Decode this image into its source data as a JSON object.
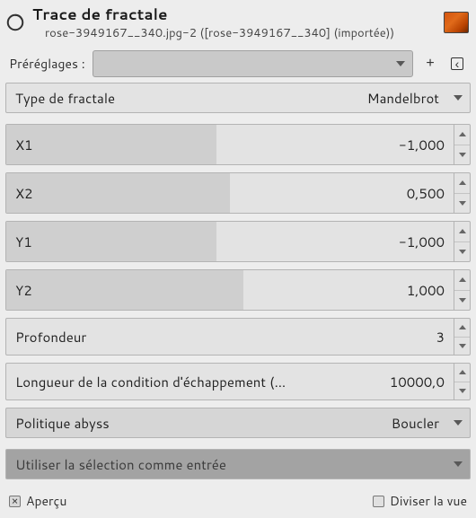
{
  "header": {
    "title": "Trace de fractale",
    "subtitle": "rose-3949167__340.jpg-2 ([rose-3949167__340] (importée))"
  },
  "presets": {
    "label": "Préréglages :"
  },
  "fractal_type": {
    "label": "Type de fractale",
    "value": "Mandelbrot"
  },
  "params": {
    "x1": {
      "label": "X1",
      "value": "-1,000",
      "fill_pct": 47
    },
    "x2": {
      "label": "X2",
      "value": "0,500",
      "fill_pct": 50
    },
    "y1": {
      "label": "Y1",
      "value": "-1,000",
      "fill_pct": 47
    },
    "y2": {
      "label": "Y2",
      "value": "1,000",
      "fill_pct": 53
    },
    "depth": {
      "label": "Profondeur",
      "value": "3",
      "fill_pct": 0
    },
    "escape": {
      "label": "Longueur de la condition d'échappement (…",
      "value": "10000,0",
      "fill_pct": 0
    }
  },
  "abyss": {
    "label": "Politique abyss",
    "value": "Boucler"
  },
  "use_selection": {
    "label": "Utiliser la sélection comme entrée"
  },
  "footer": {
    "preview": "Aperçu",
    "split": "Diviser la vue"
  }
}
